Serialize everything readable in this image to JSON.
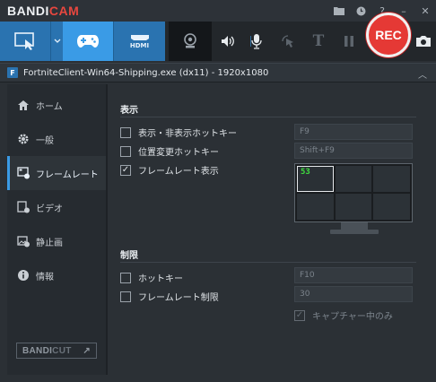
{
  "app": {
    "brand_main": "BANDI",
    "brand_accent": "CAM",
    "window_buttons": [
      "folder-icon",
      "clock-icon",
      "help-icon",
      "minimize-icon",
      "close-icon"
    ]
  },
  "toolbar": {
    "rec_label": "REC",
    "hdmi_label": "HDMI"
  },
  "target": {
    "title": "FortniteClient-Win64-Shipping.exe (dx11) - 1920x1080",
    "icon_letter": "F"
  },
  "sidebar": {
    "items": [
      {
        "label": "ホーム",
        "icon": "home-icon"
      },
      {
        "label": "一般",
        "icon": "gear-icon"
      },
      {
        "label": "フレームレート",
        "icon": "fps-icon"
      },
      {
        "label": "ビデオ",
        "icon": "video-icon"
      },
      {
        "label": "静止画",
        "icon": "image-icon"
      },
      {
        "label": "情報",
        "icon": "info-icon"
      }
    ],
    "active_index": 2,
    "bandicut_main": "BANDI",
    "bandicut_accent": "CUT"
  },
  "display_section": {
    "title": "表示",
    "options": [
      {
        "label": "表示・非表示ホットキー",
        "checked": false,
        "value": "F9"
      },
      {
        "label": "位置変更ホットキー",
        "checked": false,
        "value": "Shift+F9"
      },
      {
        "label": "フレームレート表示",
        "checked": true
      }
    ],
    "fps_value": "53"
  },
  "limit_section": {
    "title": "制限",
    "options": [
      {
        "label": "ホットキー",
        "checked": false,
        "value": "F10"
      },
      {
        "label": "フレームレート制限",
        "checked": false,
        "value": "30"
      }
    ],
    "capture_only": {
      "label": "キャプチャー中のみ",
      "checked": true,
      "disabled": true
    }
  },
  "colors": {
    "accent": "#3a9be6",
    "rec": "#e53935",
    "fps_text": "#3fdc3f"
  }
}
